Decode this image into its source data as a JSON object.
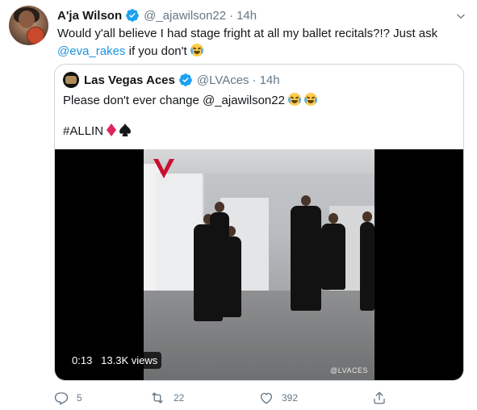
{
  "tweet": {
    "author_name": "A'ja Wilson",
    "handle": "@_ajawilson22",
    "separator": "·",
    "time": "14h",
    "text_before": "Would y'all believe I had stage fright at all my ballet recitals?!? Just ask ",
    "mention": "@eva_rakes",
    "text_after": " if you don't ",
    "avatar_icon": "profile-photo"
  },
  "quote": {
    "author_name": "Las Vegas Aces",
    "handle": "@LVAces",
    "separator": "·",
    "time": "14h",
    "text": "Please don't ever change @_ajawilson22 ",
    "hashtag_line": "#ALLIN ",
    "video": {
      "duration": "0:13",
      "views": "13.3K views",
      "watermark": "@LVACES"
    }
  },
  "actions": {
    "replies": "5",
    "retweets": "22",
    "likes": "392"
  },
  "colors": {
    "link": "#1b95e0",
    "verified": "#1da1f2",
    "muted": "#657786",
    "border": "#ccd6dd",
    "diamond": "#e0245e",
    "brand_red": "#c8102e"
  }
}
